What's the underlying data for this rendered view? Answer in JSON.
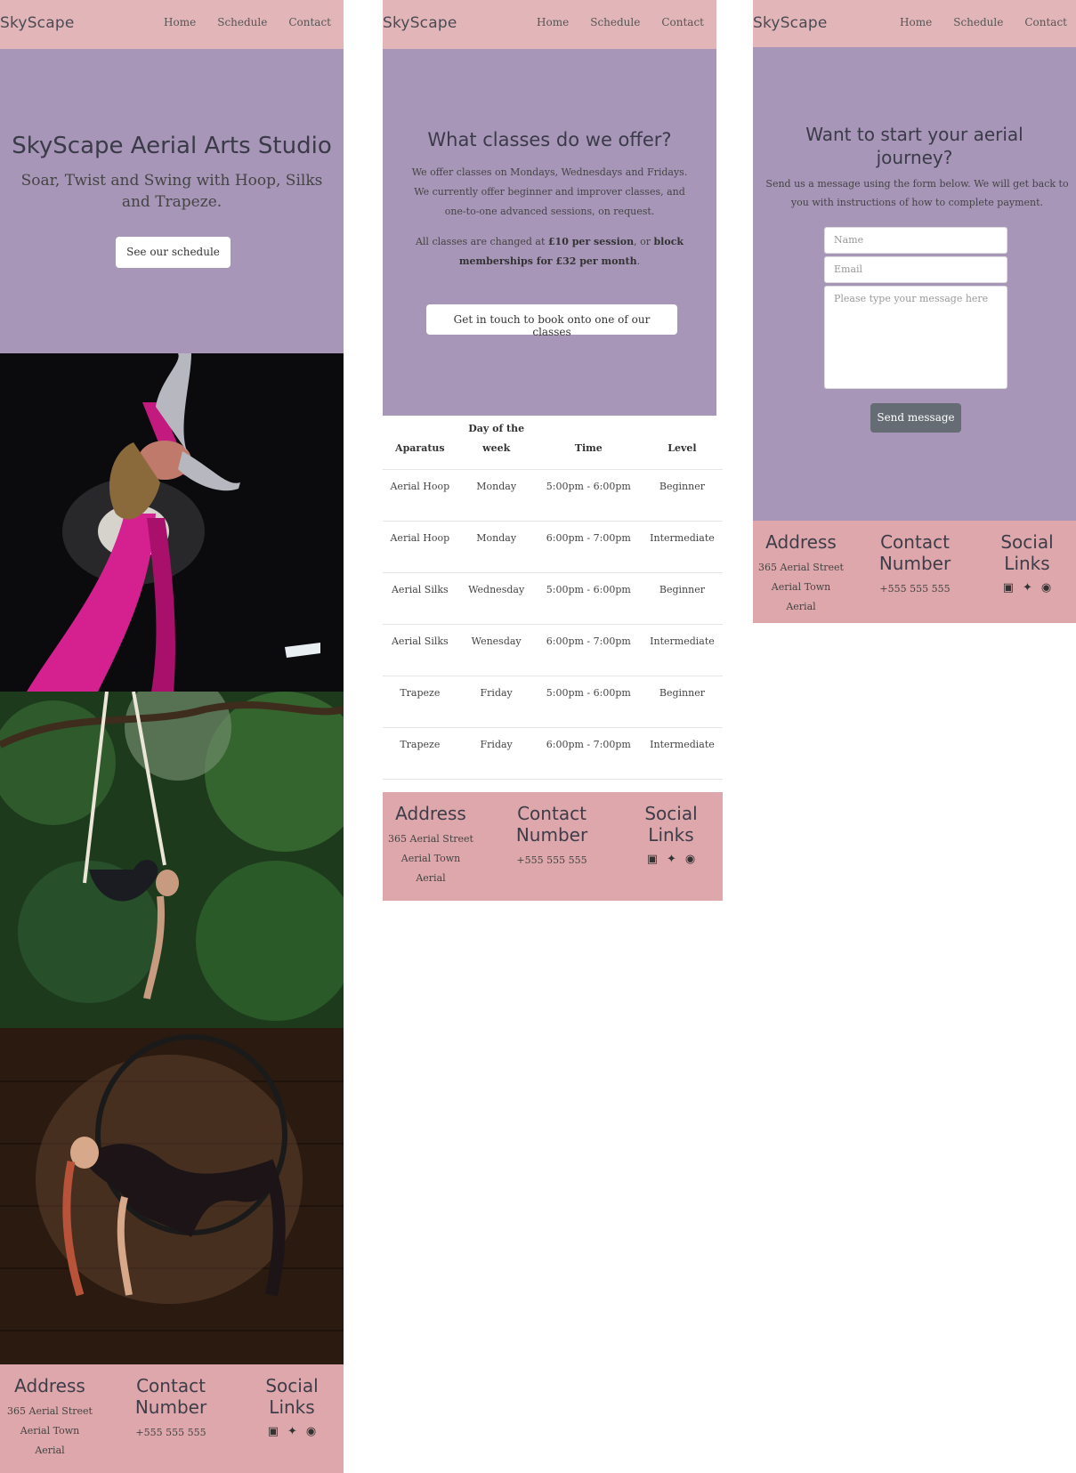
{
  "brand": "SkyScape",
  "nav": {
    "home": "Home",
    "schedule": "Schedule",
    "contact": "Contact"
  },
  "home": {
    "title": "SkyScape Aerial Arts Studio",
    "subtitle": "Soar, Twist and Swing with Hoop, Silks and Trapeze.",
    "cta": "See our schedule"
  },
  "schedule": {
    "heading": "What classes do we offer?",
    "intro": "We offer classes on Mondays, Wednesdays and Fridays. We currently offer beginner and improver classes, and one-to-one advanced sessions, on request.",
    "prices_prefix": "All classes are changed at ",
    "price_session": "£10 per session",
    "prices_mid": ", or ",
    "price_block": "block memberships for £32 per month",
    "prices_suffix": ".",
    "cta": "Get in touch to book onto one of our classes",
    "table": {
      "headers": [
        "Aparatus",
        "Day of the week",
        "Time",
        "Level"
      ],
      "rows": [
        [
          "Aerial Hoop",
          "Monday",
          "5:00pm - 6:00pm",
          "Beginner"
        ],
        [
          "Aerial Hoop",
          "Monday",
          "6:00pm - 7:00pm",
          "Intermediate"
        ],
        [
          "Aerial Silks",
          "Wednesday",
          "5:00pm - 6:00pm",
          "Beginner"
        ],
        [
          "Aerial Silks",
          "Wenesday",
          "6:00pm - 7:00pm",
          "Intermediate"
        ],
        [
          "Trapeze",
          "Friday",
          "5:00pm - 6:00pm",
          "Beginner"
        ],
        [
          "Trapeze",
          "Friday",
          "6:00pm - 7:00pm",
          "Intermediate"
        ]
      ]
    }
  },
  "contact": {
    "heading": "Want to start your aerial journey?",
    "intro": "Send us a message using the form below. We will get back to you with instructions of how to complete payment.",
    "name_placeholder": "Name",
    "email_placeholder": "Email",
    "message_placeholder": "Please type your message here",
    "submit": "Send message"
  },
  "footer": {
    "address_heading": "Address",
    "address_line1": "365 Aerial Street",
    "address_line2": "Aerial Town",
    "address_line3": "Aerial",
    "contact_heading": "Contact Number",
    "phone": "+555 555 555",
    "social_heading": "Social Links",
    "icons": [
      "facebook-icon",
      "twitter-icon",
      "instagram-icon"
    ]
  },
  "colors": {
    "navbar": "#e2b6b8",
    "hero": "#a796b8",
    "footer": "#dea7ab",
    "silks": "#d4218f",
    "button_dark": "#656c73"
  }
}
